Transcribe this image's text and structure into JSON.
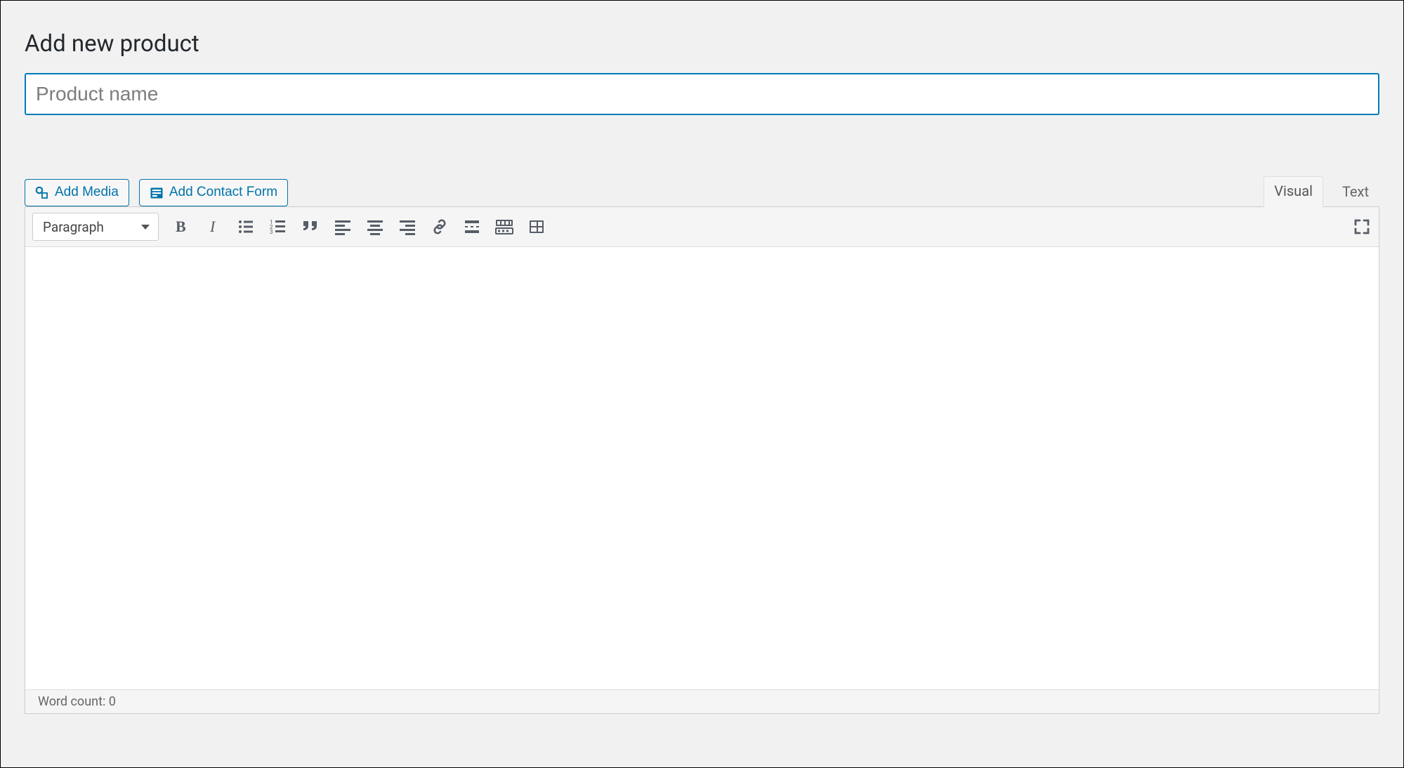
{
  "header": {
    "title": "Add new product"
  },
  "title_field": {
    "placeholder": "Product name",
    "value": ""
  },
  "media_buttons": {
    "add_media": "Add Media",
    "add_contact_form": "Add Contact Form"
  },
  "tabs": {
    "visual": "Visual",
    "text": "Text",
    "active": "visual"
  },
  "toolbar": {
    "format_selector": "Paragraph",
    "icons": {
      "bold": "bold-icon",
      "italic": "italic-icon",
      "bullet_list": "bullet-list-icon",
      "numbered_list": "numbered-list-icon",
      "blockquote": "blockquote-icon",
      "align_left": "align-left-icon",
      "align_center": "align-center-icon",
      "align_right": "align-right-icon",
      "link": "link-icon",
      "read_more": "read-more-icon",
      "toolbar_toggle": "toolbar-toggle-icon",
      "table": "table-icon",
      "fullscreen": "fullscreen-icon"
    }
  },
  "editor": {
    "content": ""
  },
  "statusbar": {
    "word_count_label": "Word count: 0"
  }
}
